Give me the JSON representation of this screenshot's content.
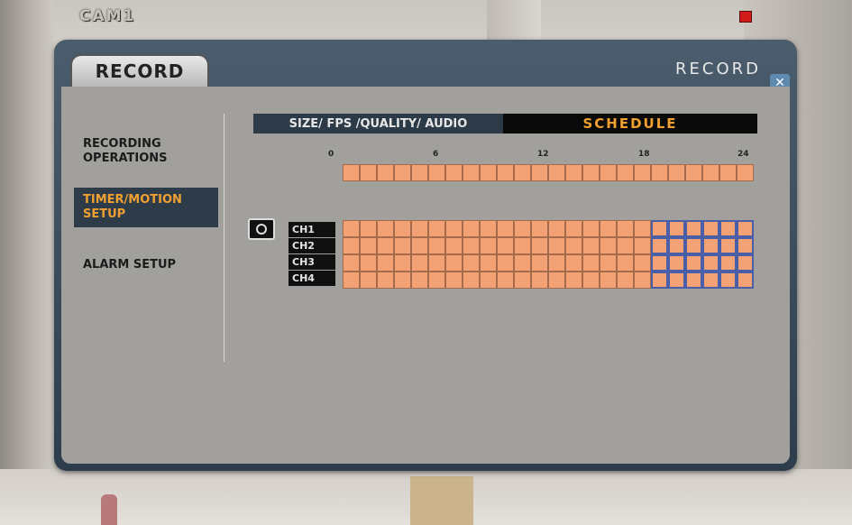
{
  "overlay": {
    "cam_label": "CAM1",
    "record_indicator_color": "#d21a1a"
  },
  "window": {
    "tab_label": "RECORD",
    "title": "RECORD",
    "close_symbol": "✕"
  },
  "menu": [
    {
      "label": "RECORDING OPERATIONS"
    },
    {
      "label": "TIMER/MOTION SETUP",
      "active": true
    },
    {
      "label": "ALARM SETUP"
    }
  ],
  "tabs": {
    "size_fps": "SIZE/ FPS /QUALITY/ AUDIO",
    "schedule": "SCHEDULE"
  },
  "schedule": {
    "axis_ticks": [
      "0",
      "6",
      "12",
      "18",
      "24"
    ],
    "hours": 24,
    "channels": [
      {
        "label": "CH1",
        "blue_from_hour": 18
      },
      {
        "label": "CH2",
        "blue_from_hour": 18
      },
      {
        "label": "CH3",
        "blue_from_hour": 18
      },
      {
        "label": "CH4",
        "blue_from_hour": 18
      }
    ],
    "colors": {
      "record": "#f3a276",
      "motion_border": "#4b5fa8"
    }
  }
}
